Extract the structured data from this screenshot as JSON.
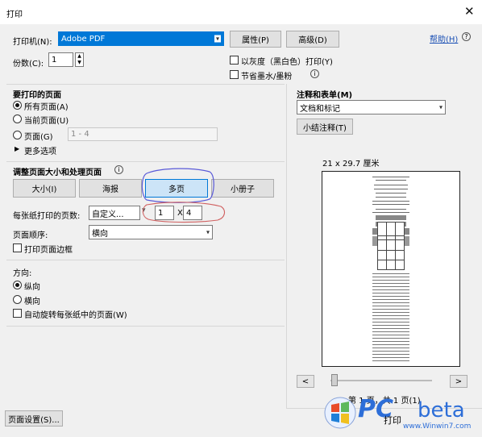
{
  "window": {
    "title": "打印",
    "close_glyph": "✕"
  },
  "printer": {
    "label": "打印机(N):",
    "selected": "Adobe PDF",
    "properties_button": "属性(P)",
    "advanced_button": "高级(D)",
    "help_link": "帮助(H)",
    "help_icon": "help-icon"
  },
  "copies": {
    "label": "份数(C):",
    "value": "1",
    "grayscale_label": "以灰度（黑白色）打印(Y)",
    "save_ink_label": "节省墨水/墨粉"
  },
  "pages_to_print": {
    "heading": "要打印的页面",
    "all_pages": "所有页面(A)",
    "current_page": "当前页面(U)",
    "pages": "页面(G)",
    "pages_value": "1 - 4",
    "more_options": "更多选项"
  },
  "page_sizing": {
    "heading": "调整页面大小和处理页面",
    "tabs": [
      "大小(I)",
      "海报",
      "多页",
      "小册子"
    ],
    "selected_tab": "多页",
    "pages_per_sheet_label": "每张纸打印的页数:",
    "pages_per_sheet_value": "自定义...",
    "cols": "1",
    "x_label": "X",
    "rows": "4",
    "page_order_label": "页面顺序:",
    "page_order_value": "横向",
    "print_border_label": "打印页面边框"
  },
  "orientation": {
    "heading": "方向:",
    "portrait": "纵向",
    "landscape": "横向",
    "auto_rotate": "自动旋转每张纸中的页面(W)"
  },
  "comments": {
    "heading": "注释和表单(M)",
    "selected": "文档和标记",
    "summarize_button": "小结注释(T)"
  },
  "preview": {
    "paper_size": "21 x 29.7 厘米",
    "prev": "<",
    "next": ">",
    "page_status": "第 1 页，共 1 页(1)"
  },
  "footer": {
    "page_setup_button": "页面设置(S)...",
    "print_button": "打印"
  },
  "watermark": {
    "brand": "PC",
    "text": "beta",
    "url": "www.Winwin7.com"
  },
  "colors": {
    "accent": "#0063b1",
    "annot_blue": "#5a5ad8",
    "annot_red": "#d06060"
  }
}
